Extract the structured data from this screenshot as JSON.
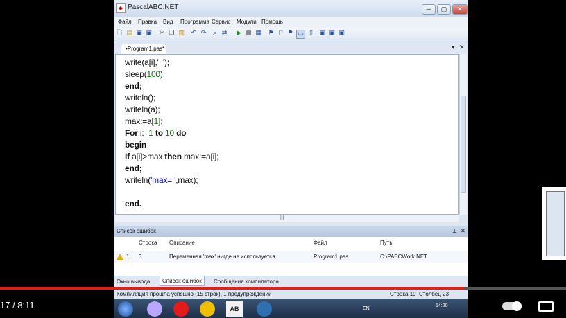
{
  "window": {
    "title": "PascalABC.NET",
    "min": "─",
    "max": "▢",
    "close": "✕"
  },
  "menu": [
    "Файл",
    "Правка",
    "Вид",
    "Программа",
    "Сервис",
    "Модули",
    "Помощь"
  ],
  "editor": {
    "tab_label": "•Program1.pas*",
    "tab_dropdown": "▾",
    "tab_close": "✕",
    "lines": [
      "write(a[i],'  ');",
      "sleep(100);",
      "end;",
      "writeln();",
      "writeln(a);",
      "max:=a[1];",
      "For i:=1 to 10 do",
      "begin",
      "If a[i]>max then max:=a[i];",
      "end;",
      "writeln('max= ',max);",
      "",
      "end."
    ]
  },
  "errors": {
    "title": "Список ошибок",
    "columns": {
      "line": "Строка",
      "desc": "Описание",
      "file": "Файл",
      "path": "Путь"
    },
    "rows": [
      {
        "num": "1",
        "line": "3",
        "desc": "Переменная 'max' нигде не используется",
        "file": "Program1.pas",
        "path": "C:\\PABCWork.NET"
      }
    ]
  },
  "bottom_tabs": [
    "Окно вывода",
    "Список ошибок",
    "Сообщения компилятора"
  ],
  "status": {
    "message": "Компиляция прошла успешно (15 строк), 1 предупреждений",
    "row": "Строка  19",
    "col": "Столбец  23"
  },
  "taskbar": {
    "lang": "EN",
    "clock": "14:20"
  },
  "video": {
    "time": "17 / 8:11",
    "progress_fraction": 0.82
  },
  "colors": {
    "progress": "#e51e17",
    "keyword_blue": "#0000cc",
    "number_green": "#008000"
  }
}
